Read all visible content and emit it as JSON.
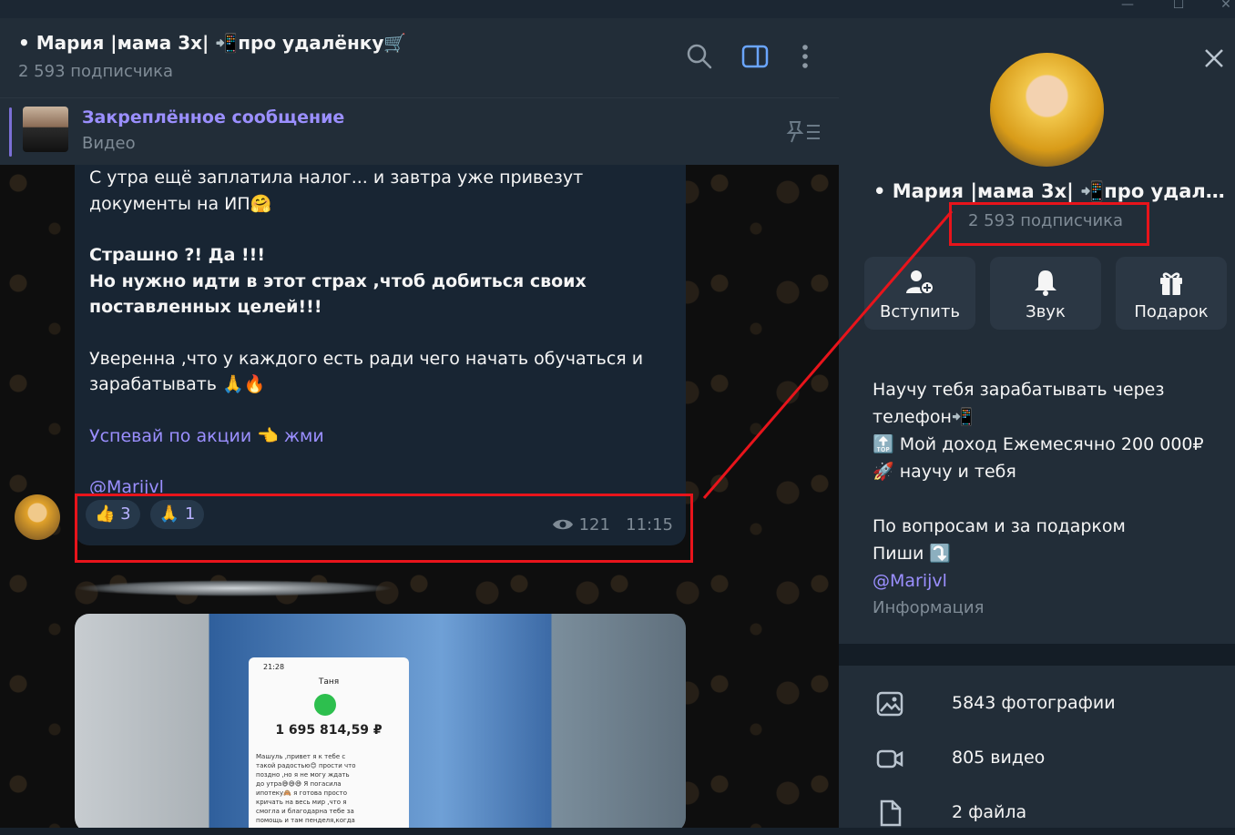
{
  "window": {
    "minimize_glyph": "—",
    "maximize_glyph": "☐",
    "close_glyph": "✕"
  },
  "chat": {
    "title": "• Мария |мама 3х| 📲про удалёнку🛒",
    "subscribers": "2 593 подписчика"
  },
  "pinned": {
    "title": "Закреплённое сообщение",
    "subtitle": "Видео"
  },
  "message": {
    "line1": "С утра ещё заплатила налог... и завтра уже привезут документы на ИП🤗",
    "bold1": "Страшно ?! Да !!!",
    "bold2": "Но нужно идти в этот страх ,чтоб добиться своих поставленных целей!!!",
    "line2": "Уверенна ,что у каждого есть ради чего начать обучаться и зарабатывать 🙏🔥",
    "promo": "Успевай по акции 👈 жми",
    "mention": "@Marijvl",
    "reactions": [
      {
        "emoji": "👍",
        "count": "3"
      },
      {
        "emoji": "🙏",
        "count": "1"
      }
    ],
    "views": "121",
    "time": "11:15"
  },
  "media_preview": {
    "time": "21:28",
    "name": "Таня",
    "amount": "1 695 814,59 ₽",
    "text": "Машуль ,привет я к тебе с такой радостью😊 прости что поздно ,но я не могу ждать до утра😅😅😅 Я погасила ипотеку🙈 я готова просто кричать на весь мир ,что я смогла и благодарна тебе за помощь и там пенделя,когда я"
  },
  "profile": {
    "name": "• Мария |мама 3х| 📲про удалё...",
    "subscribers": "2 593 подписчика",
    "actions": [
      {
        "label": "Вступить",
        "icon": "add-user-icon"
      },
      {
        "label": "Звук",
        "icon": "bell-icon"
      },
      {
        "label": "Подарок",
        "icon": "gift-icon"
      }
    ],
    "about": {
      "l1": "Научу тебя зарабатывать через телефон📲",
      "l2": "🔝 Мой доход Ежемесячно 200 000₽",
      "l3": "🚀 научу и тебя",
      "l4": "По вопросам и за подарком",
      "l5": "Пиши ⤵️",
      "link": "@Marijvl",
      "label": "Информация"
    },
    "media": [
      {
        "label": "5843 фотографии",
        "icon": "photo-icon"
      },
      {
        "label": "805 видео",
        "icon": "video-icon"
      },
      {
        "label": "2 файла",
        "icon": "file-icon"
      }
    ]
  },
  "colors": {
    "highlight": "#e8141b",
    "accent": "#9b8fff",
    "panel": "#222d38"
  }
}
